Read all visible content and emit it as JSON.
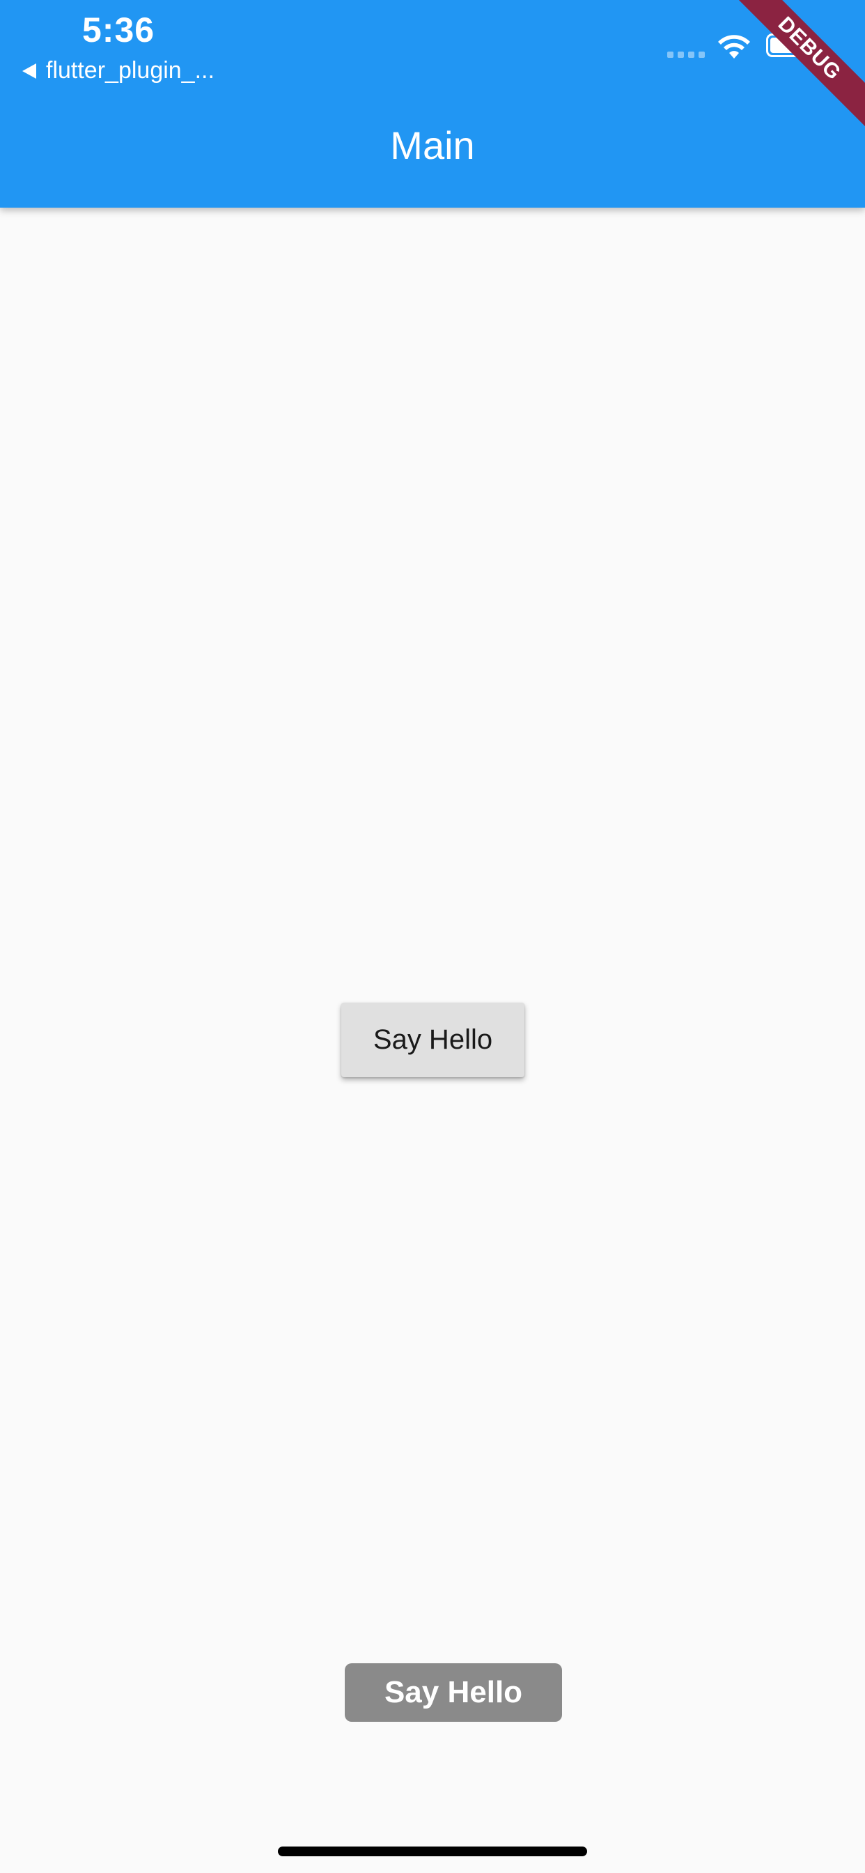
{
  "status_bar": {
    "time": "5:36",
    "back_app_label": "flutter_plugin_...",
    "icons": [
      "signal-dots-icon",
      "wifi-icon",
      "battery-icon"
    ]
  },
  "app_bar": {
    "title": "Main",
    "color": "#2196f3"
  },
  "debug_banner": {
    "label": "DEBUG",
    "color": "#8b2341"
  },
  "main": {
    "button_label": "Say Hello"
  },
  "toast": {
    "message": "Say Hello"
  }
}
